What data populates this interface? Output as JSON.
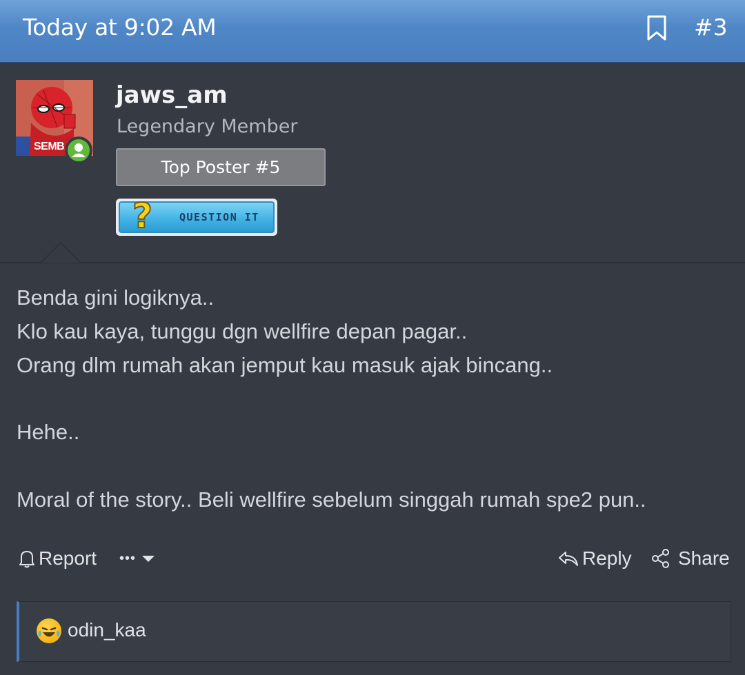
{
  "post": {
    "date": "Today at 9:02 AM",
    "number": "#3"
  },
  "user": {
    "name": "jaws_am",
    "title": "Legendary Member",
    "banner": "Top Poster #5",
    "avatar_caption": "SEMBA",
    "badge_text": "QUESTION IT",
    "badge_symbol": "?"
  },
  "message": {
    "lines": [
      "Benda gini logiknya..",
      "Klo kau kaya, tunggu dgn wellfire depan pagar..",
      "Orang dlm rumah akan jemput kau masuk ajak bincang..",
      "",
      "Hehe..",
      "",
      "Moral of the story.. Beli wellfire sebelum singgah rumah spe2 pun.."
    ]
  },
  "actions": {
    "report": "Report",
    "more": "•••",
    "reply": "Reply",
    "share": "Share"
  },
  "reactions": {
    "users": "odin_kaa"
  }
}
